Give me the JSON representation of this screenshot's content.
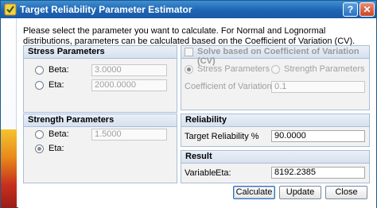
{
  "window": {
    "title": "Target Reliability Parameter Estimator",
    "help_glyph": "?",
    "close_glyph": "✕"
  },
  "intro_text": "Please select the parameter you want to calculate. For Normal and Lognormal distributions, parameters can be calculated based on the Coefficient of Variation (CV).",
  "stress": {
    "title": "Stress Parameters",
    "beta_label": "Beta:",
    "beta_value": "3.0000",
    "eta_label": "Eta:",
    "eta_value": "2000.0000"
  },
  "strength": {
    "title": "Strength Parameters",
    "beta_label": "Beta:",
    "beta_value": "1.5000",
    "eta_label": "Eta:"
  },
  "cv": {
    "title": "Solve based on Coefficient of Variation (CV)",
    "stress_option": "Stress Parameters",
    "strength_option": "Strength Parameters",
    "cv_label": "Coefficient of Variation (CV",
    "cv_value": "0.1"
  },
  "reliability": {
    "title": "Reliability",
    "label": "Target Reliability %",
    "value": "90.0000"
  },
  "result": {
    "title": "Result",
    "variable_label": "Variable",
    "param_label": "Eta:",
    "value": "8192.2385"
  },
  "buttons": {
    "calculate": "Calculate",
    "update": "Update",
    "close": "Close"
  },
  "colors": {
    "titlebar": "#1d64b3",
    "group_border": "#a9bdd8"
  }
}
